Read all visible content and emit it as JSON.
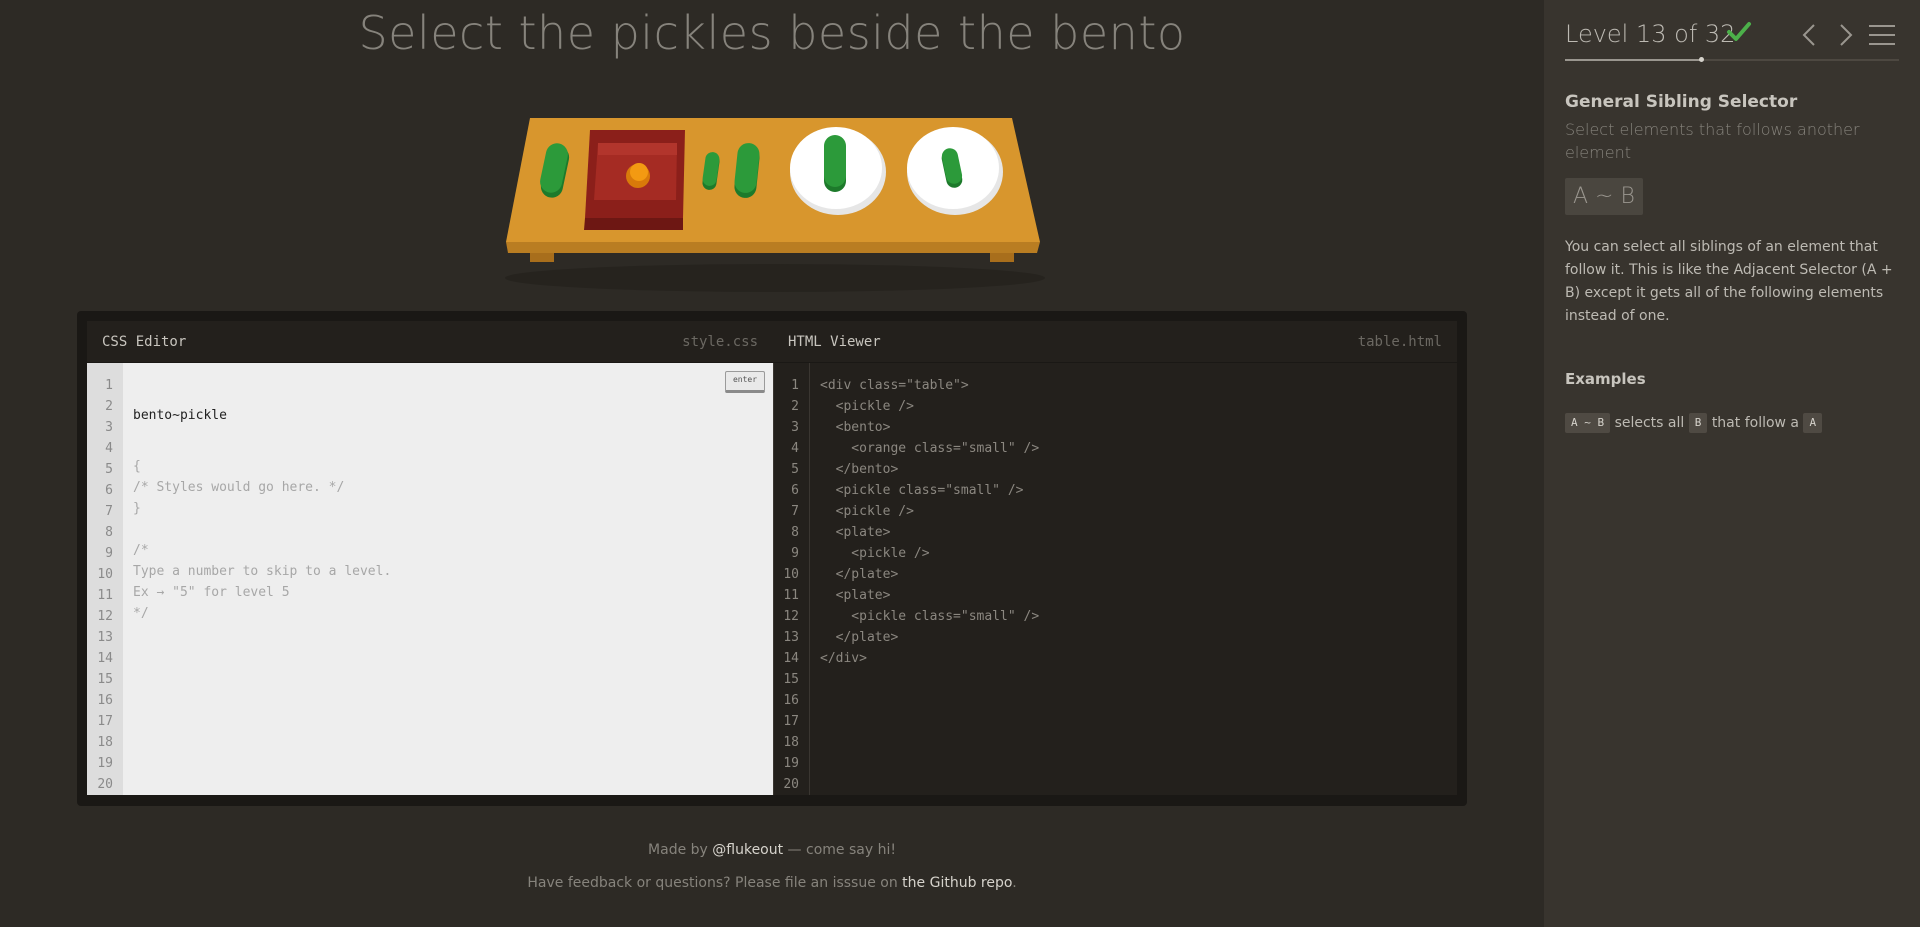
{
  "game": {
    "order": "Select the pickles beside the bento"
  },
  "table": {
    "items": [
      {
        "type": "pickle",
        "size": "normal"
      },
      {
        "type": "bento",
        "contents": "orange small"
      },
      {
        "type": "pickle",
        "size": "small"
      },
      {
        "type": "pickle",
        "size": "normal"
      },
      {
        "type": "plate",
        "contents": "pickle"
      },
      {
        "type": "plate",
        "contents": "pickle small"
      }
    ],
    "colors": {
      "wood": "#d8962d",
      "wood_edge": "#b97d22",
      "bento": "#8b1f1a",
      "pickle": "#2c9a3a",
      "plate": "#ffffff",
      "orange": "#f39a12"
    }
  },
  "css_editor": {
    "title": "CSS Editor",
    "file": "style.css",
    "enter_label": "enter",
    "input_value": "bento~pickle",
    "lines": [
      "{",
      "/* Styles would go here. */",
      "}",
      "",
      "/*",
      "Type a number to skip to a level.",
      "Ex → \"5\" for level 5",
      "*/"
    ],
    "line_numbers": [
      "1",
      "2",
      "3",
      "4",
      "5",
      "6",
      "7",
      "8",
      "9",
      "10",
      "11",
      "12",
      "13",
      "14",
      "15",
      "16",
      "17",
      "18",
      "19",
      "20"
    ]
  },
  "html_viewer": {
    "title": "HTML Viewer",
    "file": "table.html",
    "lines": [
      "<div class=\"table\">",
      "  <pickle />",
      "  <bento>",
      "    <orange class=\"small\" />",
      "  </bento>",
      "  <pickle class=\"small\" />",
      "  <pickle />",
      "  <plate>",
      "    <pickle />",
      "  </plate>",
      "  <plate>",
      "    <pickle class=\"small\" />",
      "  </plate>",
      "</div>"
    ],
    "line_numbers": [
      "1",
      "2",
      "3",
      "4",
      "5",
      "6",
      "7",
      "8",
      "9",
      "10",
      "11",
      "12",
      "13",
      "14",
      "15",
      "16",
      "17",
      "18",
      "19",
      "20"
    ]
  },
  "footer": {
    "made_by_prefix": "Made by ",
    "made_by_link": "@flukeout",
    "made_by_suffix": " — come say hi!",
    "feedback_prefix": "Have feedback or questions? Please file an isssue on ",
    "feedback_link": "the Github repo",
    "feedback_suffix": "."
  },
  "sidebar": {
    "level_text": "Level 13 of 32",
    "level_current": 13,
    "level_total": 32,
    "completed": true,
    "selector_name": "General Sibling Selector",
    "title": "Select elements that follows another element",
    "syntax": "A ~ B",
    "hint": "You can select all siblings of an element that follow it. This is like the Adjacent Selector (A + B) except it gets all of the following elements instead of one.",
    "examples_title": "Examples",
    "example": {
      "tag1": "A ~ B",
      "text1": "selects all",
      "tag2": "B",
      "text2": "that follow a",
      "tag3": "A"
    },
    "icons": {
      "check": "checkmark-icon",
      "prev": "chevron-left-icon",
      "next": "chevron-right-icon",
      "menu": "hamburger-menu-icon"
    },
    "accent_color": "#4cb04a"
  }
}
